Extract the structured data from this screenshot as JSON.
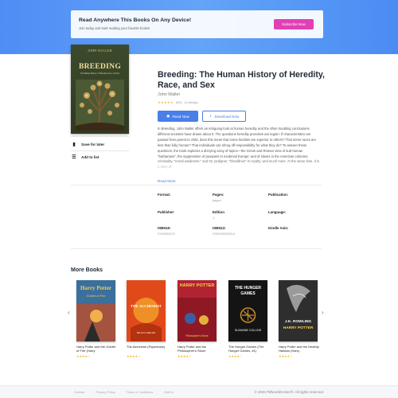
{
  "banner": {
    "title": "Read Anywhere This Books On Any Device!",
    "subtitle": "Join today and start reading your favorite books!",
    "cta": "Subscribe Now"
  },
  "book": {
    "cover": {
      "author": "JOHN WALLER",
      "title": "BREEDING",
      "subtitle": "The Human History of Heredity, Race, and Sex"
    },
    "title": "Breeding: The Human History of Heredity, Race, and Sex",
    "author": "John Waller",
    "rating_text": "(0/5)",
    "rating_count": "(0 ratings)",
    "read_label": "Read Now",
    "download_label": "Download Now",
    "description": "In Breeding, John Waller offers an intriguing look at human heredity and the often troubling conclusions different societies have drawn about it. The questions heredity provokes are legion: If characteristics are passed from parent to child, does this mean that some families are superior to others? That some races are less than fully human? That individuals can shrug off responsibility for what they do? To answer these questions, the book explores a dizzying array of topics—the Greek and Roman view of sub-human \"barbarians\"; the suppression of peasants in medieval Europe; and of slaves in the American colonies; criminality, \"moral weakness,\" and IQ; pedigree; \"bloodlines\" in royalty; and much more. At the same time, it is a story of",
    "read_more": "Read More",
    "save_label": "Save for later",
    "add_label": "Add to list",
    "meta": {
      "format_label": "Format:",
      "format_value": "",
      "pages_label": "Pages:",
      "pages_value": "pages",
      "publication_label": "Publication:",
      "publication_value": "",
      "publisher_label": "Publisher:",
      "publisher_value": "",
      "edition_label": "Edition",
      "edition_value": "1",
      "language_label": "Language:",
      "language_value": "",
      "isbn10_label": "ISBN10:",
      "isbn10_value": "0199253213",
      "isbn13_label": "ISBN13:",
      "isbn13_value": "9780199253214",
      "asin_label": "Kindle Asin:",
      "asin_value": ""
    }
  },
  "more_books": {
    "title": "More Books",
    "items": [
      {
        "name": "Harry Potter and the Goblet of Fire (Harry",
        "stars": "★★★★☆",
        "cover_top": "Harry Potter",
        "cover_bottom": "Goblet of Fire",
        "color": "#3a6f9e"
      },
      {
        "name": "The Alchemist (Paperback)",
        "stars": "★★★★☆",
        "cover_top": "THE ALCHEMIST",
        "cover_bottom": "PAULO COELHO",
        "color": "#e04a1b"
      },
      {
        "name": "Harry Potter and the Philosopher's Stone",
        "stars": "★★★★☆",
        "cover_top": "HARRY POTTER",
        "cover_bottom": "Philosopher's Stone",
        "color": "#b22331"
      },
      {
        "name": "The Hunger Games (The Hunger Games, #1)",
        "stars": "★★★★☆",
        "cover_top": "THE HUNGER GAMES",
        "cover_bottom": "SUZANNE COLLINS",
        "color": "#141414"
      },
      {
        "name": "Harry Potter and the Deathly Hallows (Harry",
        "stars": "★★★★☆",
        "cover_top": "J.K. ROWLING",
        "cover_bottom": "HARRY POTTER",
        "color": "#2e2e2e"
      }
    ]
  },
  "footer": {
    "links": [
      "Contact",
      "Privacy Policy",
      "Terms & Conditions",
      "DMCA"
    ],
    "copyright": "© 2025 PdfworldCenter®. All rights reserved."
  }
}
